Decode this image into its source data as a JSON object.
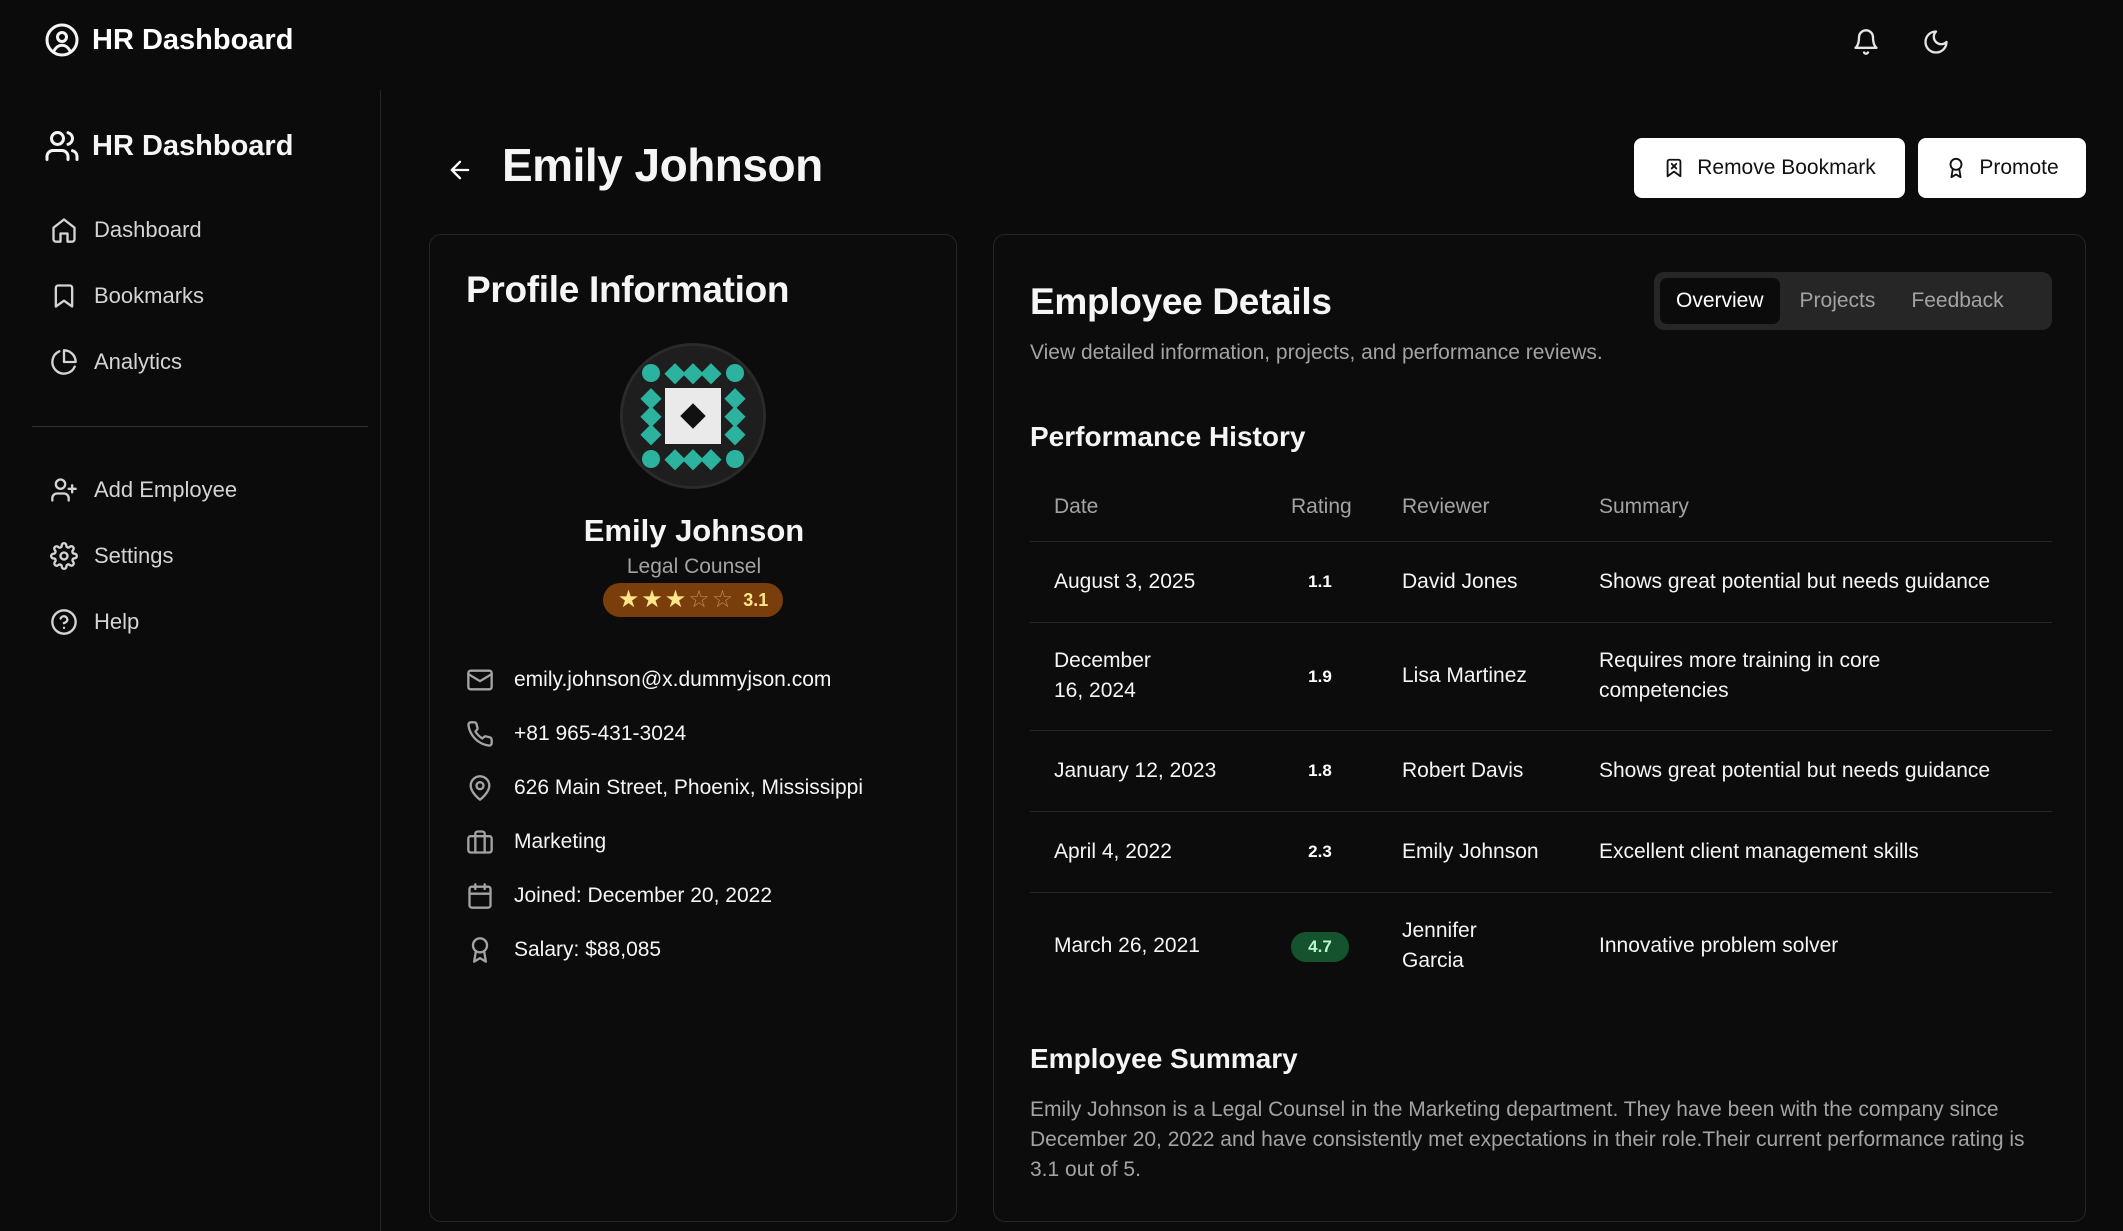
{
  "topbar": {
    "brand": "HR Dashboard",
    "brand_icon": "user-circle-icon"
  },
  "sidebar": {
    "brand": "HR Dashboard",
    "main_items": [
      {
        "label": "Dashboard",
        "icon": "home-icon"
      },
      {
        "label": "Bookmarks",
        "icon": "bookmark-icon"
      },
      {
        "label": "Analytics",
        "icon": "pie-chart-icon"
      }
    ],
    "secondary_items": [
      {
        "label": "Add Employee",
        "icon": "user-plus-icon"
      },
      {
        "label": "Settings",
        "icon": "gear-icon"
      },
      {
        "label": "Help",
        "icon": "help-circle-icon"
      }
    ]
  },
  "header": {
    "title": "Emily Johnson",
    "remove_bookmark_label": "Remove Bookmark",
    "promote_label": "Promote"
  },
  "profile": {
    "card_title": "Profile Information",
    "name": "Emily Johnson",
    "role": "Legal Counsel",
    "rating": "3.1",
    "stars_filled": 3,
    "stars_total": 5,
    "email": "emily.johnson@x.dummyjson.com",
    "phone": "+81 965-431-3024",
    "address": "626 Main Street, Phoenix, Mississippi",
    "department": "Marketing",
    "joined": "Joined: December 20, 2022",
    "salary": "Salary: $88,085"
  },
  "details": {
    "title": "Employee Details",
    "subtitle": "View detailed information, projects, and performance reviews.",
    "tabs": [
      "Overview",
      "Projects",
      "Feedback"
    ],
    "active_tab": "Overview",
    "performance": {
      "title": "Performance History",
      "columns": [
        "Date",
        "Rating",
        "Reviewer",
        "Summary"
      ],
      "rows": [
        {
          "date": "August 3, 2025",
          "rating": "1.1",
          "reviewer": "David Jones",
          "summary": "Shows great potential but needs guidance"
        },
        {
          "date": "December 16, 2024",
          "rating": "1.9",
          "reviewer": "Lisa Martinez",
          "summary": "Requires more training in core competencies"
        },
        {
          "date": "January 12, 2023",
          "rating": "1.8",
          "reviewer": "Robert Davis",
          "summary": "Shows great potential but needs guidance"
        },
        {
          "date": "April 4, 2022",
          "rating": "2.3",
          "reviewer": "Emily Johnson",
          "summary": "Excellent client management skills"
        },
        {
          "date": "March 26, 2021",
          "rating": "4.7",
          "reviewer": "Jennifer Garcia",
          "summary": "Innovative problem solver"
        }
      ]
    },
    "summary": {
      "title": "Employee Summary",
      "text": "Emily Johnson is a Legal Counsel in the Marketing department. They have been with the company since December 20, 2022 and have consistently met expectations in their role.Their current performance rating is 3.1 out of 5."
    }
  },
  "colors": {
    "background": "#0b0b0b",
    "rating_badge": "#7a3e0c",
    "star": "#fde68a",
    "good_rating": "#14532d",
    "avatar_teal": "#2bb3a0"
  }
}
